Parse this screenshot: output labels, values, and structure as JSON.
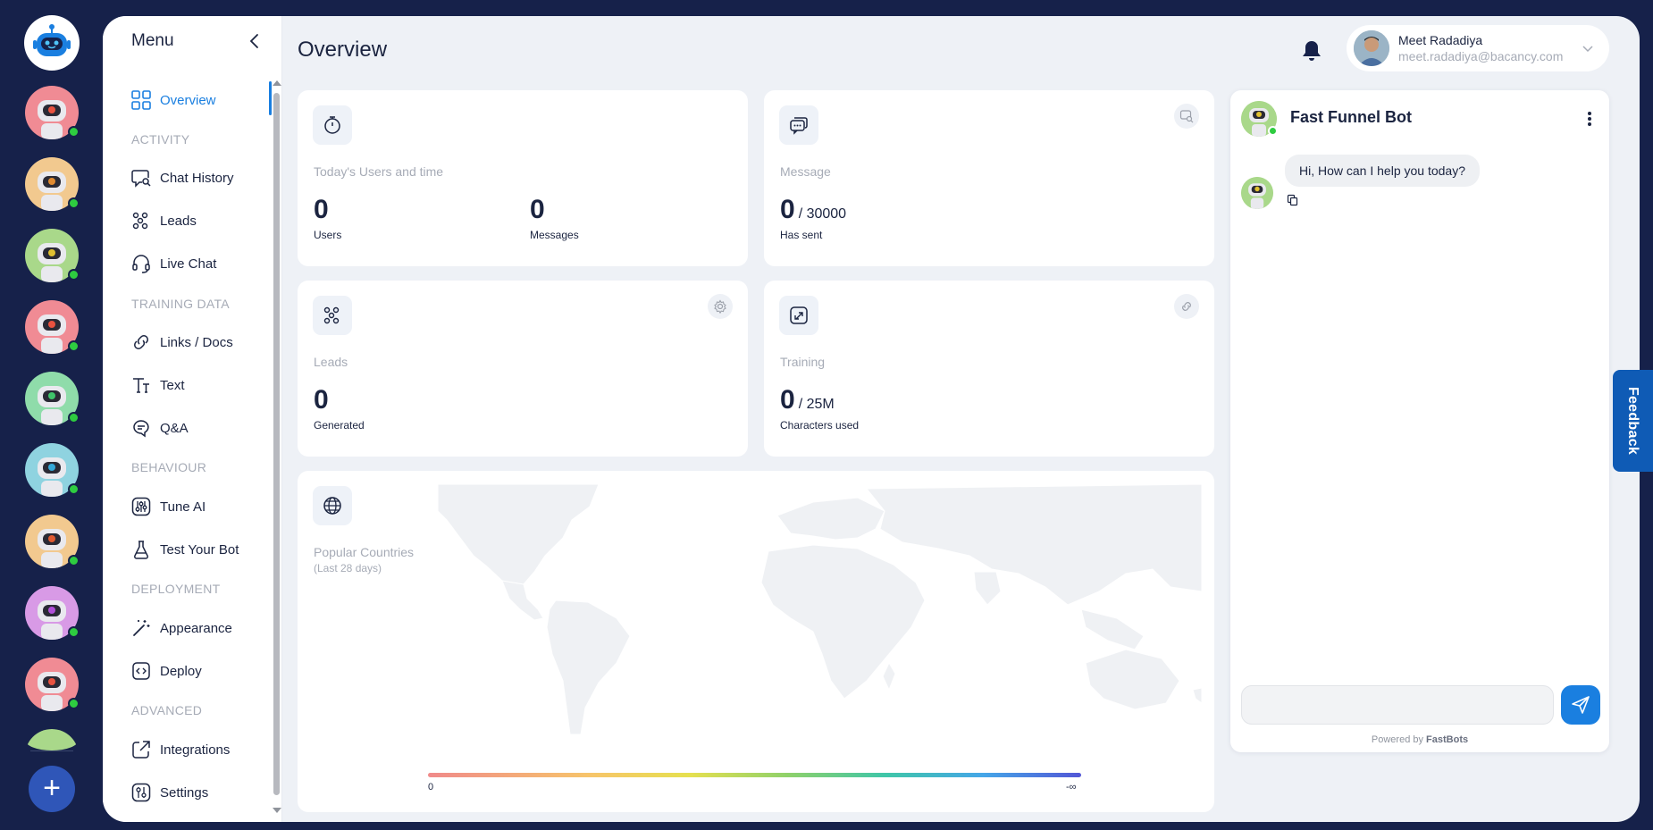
{
  "menu": {
    "title": "Menu",
    "items": {
      "overview": "Overview",
      "chat_history": "Chat History",
      "leads": "Leads",
      "live_chat": "Live Chat",
      "links_docs": "Links / Docs",
      "text": "Text",
      "qa": "Q&A",
      "tune_ai": "Tune AI",
      "test_bot": "Test Your Bot",
      "appearance": "Appearance",
      "deploy": "Deploy",
      "integrations": "Integrations",
      "settings": "Settings"
    },
    "sections": {
      "activity": "ACTIVITY",
      "training": "TRAINING DATA",
      "behaviour": "BEHAVIOUR",
      "deployment": "DEPLOYMENT",
      "advanced": "ADVANCED"
    }
  },
  "header": {
    "title": "Overview",
    "user_name": "Meet Radadiya",
    "user_email": "meet.radadiya@bacancy.com"
  },
  "cards": {
    "users": {
      "label": "Today's Users and time",
      "users_value": "0",
      "users_caption": "Users",
      "messages_value": "0",
      "messages_caption": "Messages"
    },
    "message": {
      "label": "Message",
      "value": "0",
      "limit": "/ 30000",
      "caption": "Has sent"
    },
    "leads": {
      "label": "Leads",
      "value": "0",
      "caption": "Generated"
    },
    "training": {
      "label": "Training",
      "value": "0",
      "limit": "/ 25M",
      "caption": "Characters used"
    },
    "countries": {
      "label": "Popular Countries",
      "sub": "(Last 28 days)",
      "legend_min": "0",
      "legend_max": "-∞"
    }
  },
  "chat": {
    "bot_name": "Fast Funnel Bot",
    "greeting": "Hi, How can I help you today?",
    "input_value": "",
    "powered_prefix": "Powered by",
    "powered_brand": "FastBots"
  },
  "feedback": "Feedback",
  "rail": {
    "add_label": "+"
  },
  "colors": {
    "accent": "#1a7fe0",
    "rail_bg": "#16214a",
    "online": "#2ecc40",
    "feedback": "#0f5bb5"
  }
}
